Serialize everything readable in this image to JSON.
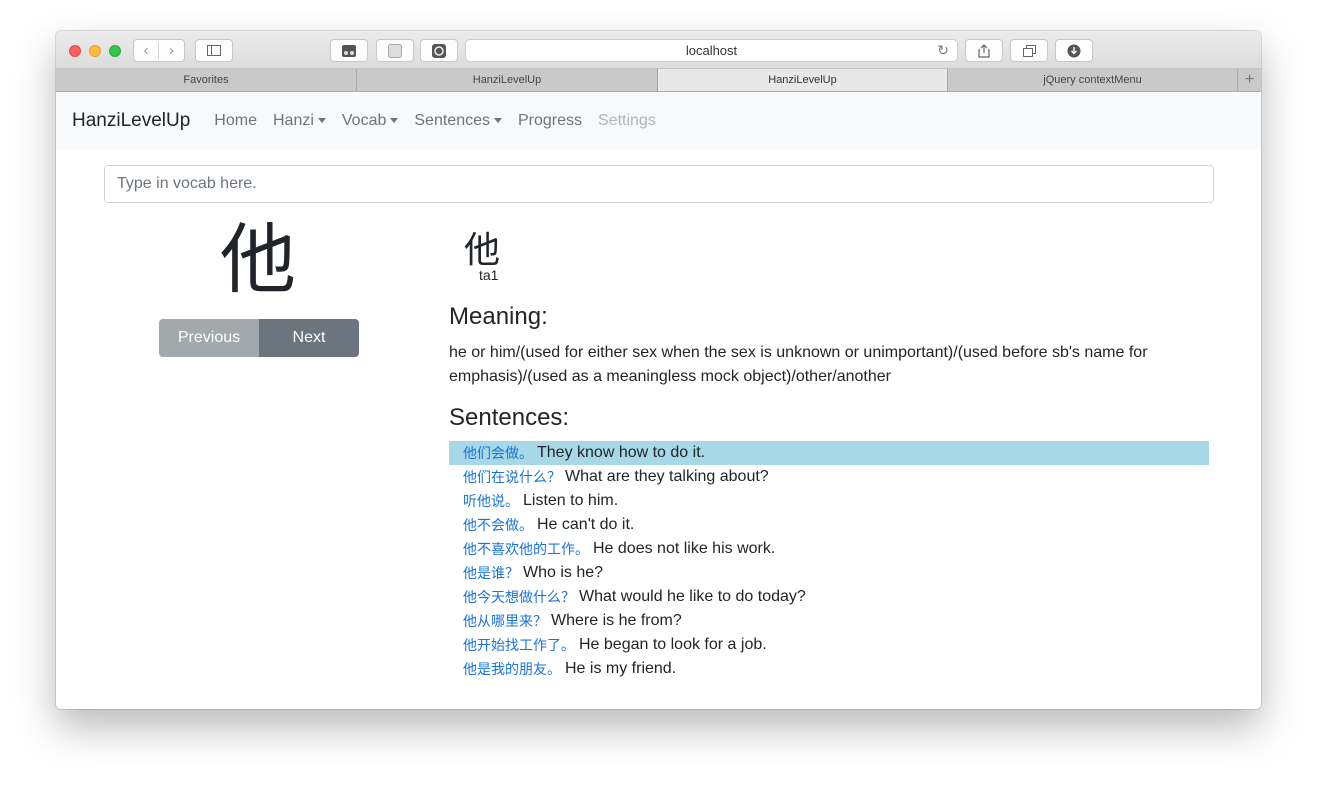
{
  "browser": {
    "url": "localhost",
    "tabs": [
      {
        "label": "Favorites"
      },
      {
        "label": "HanziLevelUp"
      },
      {
        "label": "HanziLevelUp"
      },
      {
        "label": "jQuery contextMenu"
      }
    ],
    "new_tab": "+"
  },
  "navbar": {
    "brand": "HanziLevelUp",
    "items": [
      {
        "label": "Home"
      },
      {
        "label": "Hanzi"
      },
      {
        "label": "Vocab"
      },
      {
        "label": "Sentences"
      },
      {
        "label": "Progress"
      },
      {
        "label": "Settings"
      }
    ]
  },
  "search": {
    "placeholder": "Type in vocab here."
  },
  "card": {
    "character": "他",
    "prev_label": "Previous",
    "next_label": "Next"
  },
  "detail": {
    "character": "他",
    "pinyin": "ta1",
    "meaning_heading": "Meaning:",
    "meaning": "he or him/(used for either sex when the sex is unknown or unimportant)/(used before sb's name for emphasis)/(used as a meaningless mock object)/other/another",
    "sentences_heading": "Sentences:",
    "sentences": [
      {
        "zh": "他们会做。",
        "en": "They know how to do it."
      },
      {
        "zh": "他们在说什么？",
        "en": "What are they talking about?"
      },
      {
        "zh": "听他说。",
        "en": "Listen to him."
      },
      {
        "zh": "他不会做。",
        "en": "He can't do it."
      },
      {
        "zh": "他不喜欢他的工作。",
        "en": "He does not like his work."
      },
      {
        "zh": "他是谁？",
        "en": "Who is he?"
      },
      {
        "zh": "他今天想做什么？",
        "en": "What would he like to do today?"
      },
      {
        "zh": "他从哪里来？",
        "en": "Where is he from?"
      },
      {
        "zh": "他开始找工作了。",
        "en": "He began to look for a job."
      },
      {
        "zh": "他是我的朋友。",
        "en": "He is my friend."
      }
    ]
  }
}
